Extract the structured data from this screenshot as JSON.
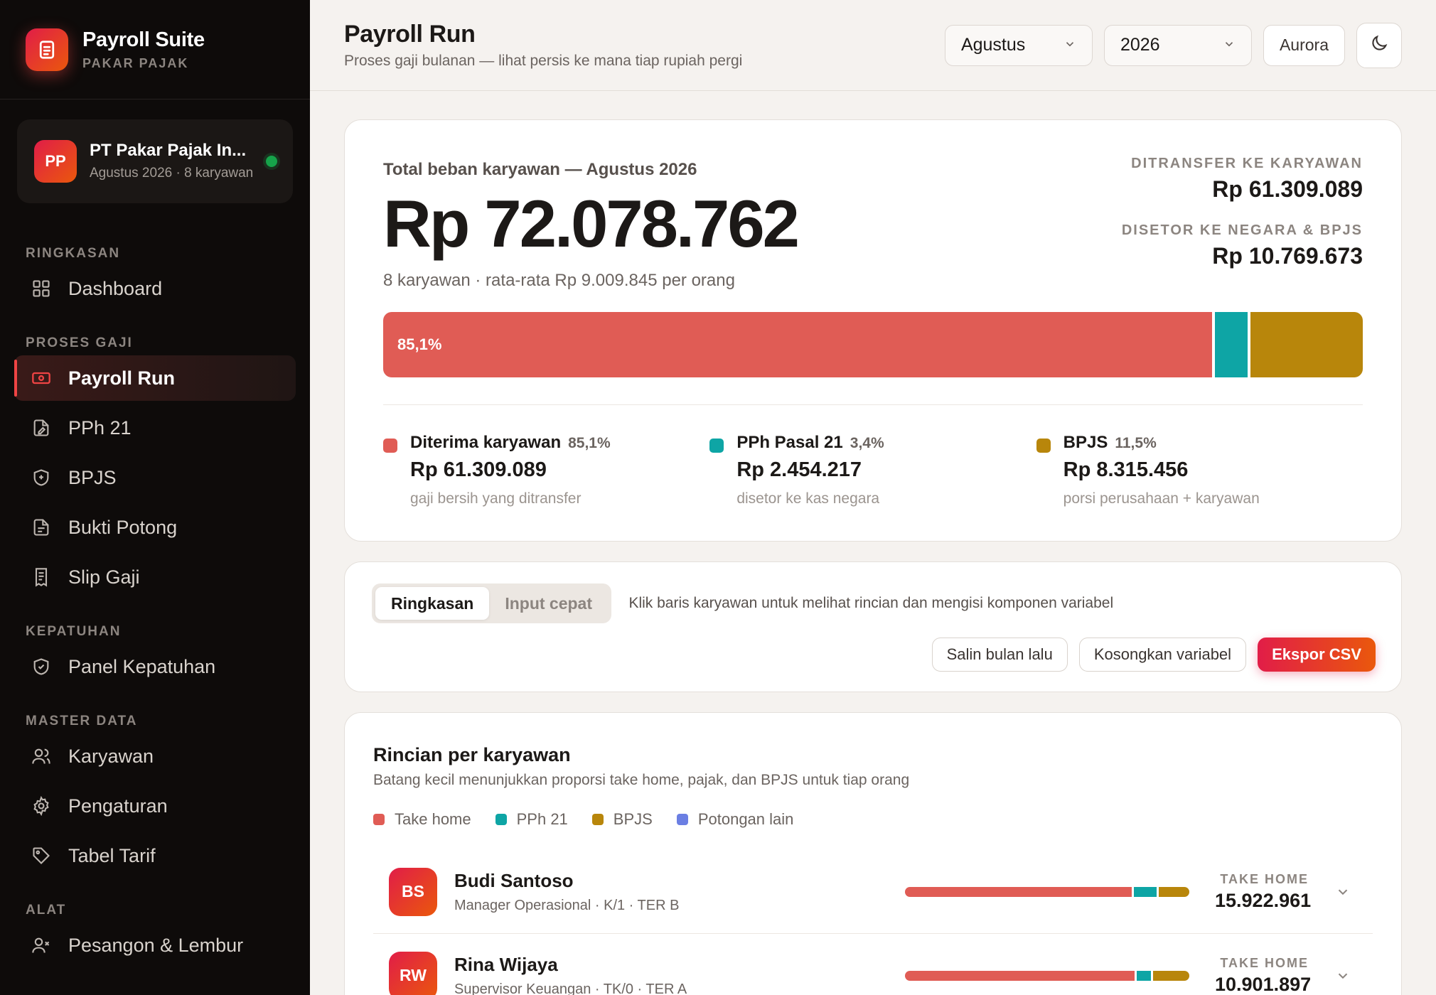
{
  "brand": {
    "name": "Payroll Suite",
    "subtitle": "PAKAR PAJAK"
  },
  "company": {
    "initials": "PP",
    "name": "PT Pakar Pajak In...",
    "meta": "Agustus 2026 · 8 karyawan"
  },
  "sidebar": {
    "sections": [
      {
        "label": "RINGKASAN",
        "items": [
          {
            "label": "Dashboard",
            "icon": "grid-icon"
          }
        ]
      },
      {
        "label": "PROSES GAJI",
        "items": [
          {
            "label": "Payroll Run",
            "icon": "money-icon",
            "active": true
          },
          {
            "label": "PPh 21",
            "icon": "file-edit-icon"
          },
          {
            "label": "BPJS",
            "icon": "shield-icon"
          },
          {
            "label": "Bukti Potong",
            "icon": "file-text-icon"
          },
          {
            "label": "Slip Gaji",
            "icon": "receipt-icon"
          }
        ]
      },
      {
        "label": "KEPATUHAN",
        "items": [
          {
            "label": "Panel Kepatuhan",
            "icon": "shield-check-icon"
          }
        ]
      },
      {
        "label": "MASTER DATA",
        "items": [
          {
            "label": "Karyawan",
            "icon": "users-icon"
          },
          {
            "label": "Pengaturan",
            "icon": "gear-icon"
          },
          {
            "label": "Tabel Tarif",
            "icon": "tag-icon"
          }
        ]
      },
      {
        "label": "ALAT",
        "items": [
          {
            "label": "Pesangon & Lembur",
            "icon": "user-x-icon"
          }
        ]
      }
    ]
  },
  "header": {
    "title": "Payroll Run",
    "subtitle": "Proses gaji bulanan — lihat persis ke mana tiap rupiah pergi",
    "month": "Agustus",
    "year": "2026",
    "theme": "Aurora"
  },
  "summary": {
    "label": "Total beban karyawan — Agustus 2026",
    "total": "Rp 72.078.762",
    "sub": "8 karyawan · rata-rata Rp 9.009.845 per orang",
    "transfer_label": "DITRANSFER KE KARYAWAN",
    "transfer_value": "Rp 61.309.089",
    "deposit_label": "DISETOR KE NEGARA & BPJS",
    "deposit_value": "Rp 10.769.673",
    "bar_label": "85,1%",
    "segments": [
      {
        "name": "Diterima karyawan",
        "pct_text": "85,1%",
        "fraction": 0.851,
        "value": "Rp 61.309.089",
        "desc": "gaji bersih yang ditransfer",
        "color": "#e05c55"
      },
      {
        "name": "PPh Pasal 21",
        "pct_text": "3,4%",
        "fraction": 0.034,
        "value": "Rp 2.454.217",
        "desc": "disetor ke kas negara",
        "color": "#0ea5a5"
      },
      {
        "name": "BPJS",
        "pct_text": "11,5%",
        "fraction": 0.115,
        "value": "Rp 8.315.456",
        "desc": "porsi perusahaan + karyawan",
        "color": "#b8860b"
      }
    ]
  },
  "toolbar": {
    "tab_summary": "Ringkasan",
    "tab_quick": "Input cepat",
    "hint": "Klik baris karyawan untuk melihat rincian dan mengisi komponen variabel",
    "copy_prev": "Salin bulan lalu",
    "clear_var": "Kosongkan variabel",
    "export": "Ekspor CSV"
  },
  "breakdown": {
    "title": "Rincian per karyawan",
    "subtitle": "Batang kecil menunjukkan proporsi take home, pajak, dan BPJS untuk tiap orang",
    "legend": [
      {
        "label": "Take home",
        "color": "#e05c55"
      },
      {
        "label": "PPh 21",
        "color": "#0ea5a5"
      },
      {
        "label": "BPJS",
        "color": "#b8860b"
      },
      {
        "label": "Potongan lain",
        "color": "#6b7fe3"
      }
    ],
    "th_label": "TAKE HOME",
    "employees": [
      {
        "initials": "BS",
        "name": "Budi Santoso",
        "meta": "Manager Operasional · K/1 · TER B",
        "take_home": "15.922.961",
        "shares": [
          0.81,
          0.08,
          0.11
        ]
      },
      {
        "initials": "RW",
        "name": "Rina Wijaya",
        "meta": "Supervisor Keuangan · TK/0 · TER A",
        "take_home": "10.901.897",
        "shares": [
          0.82,
          0.05,
          0.13
        ]
      }
    ]
  }
}
